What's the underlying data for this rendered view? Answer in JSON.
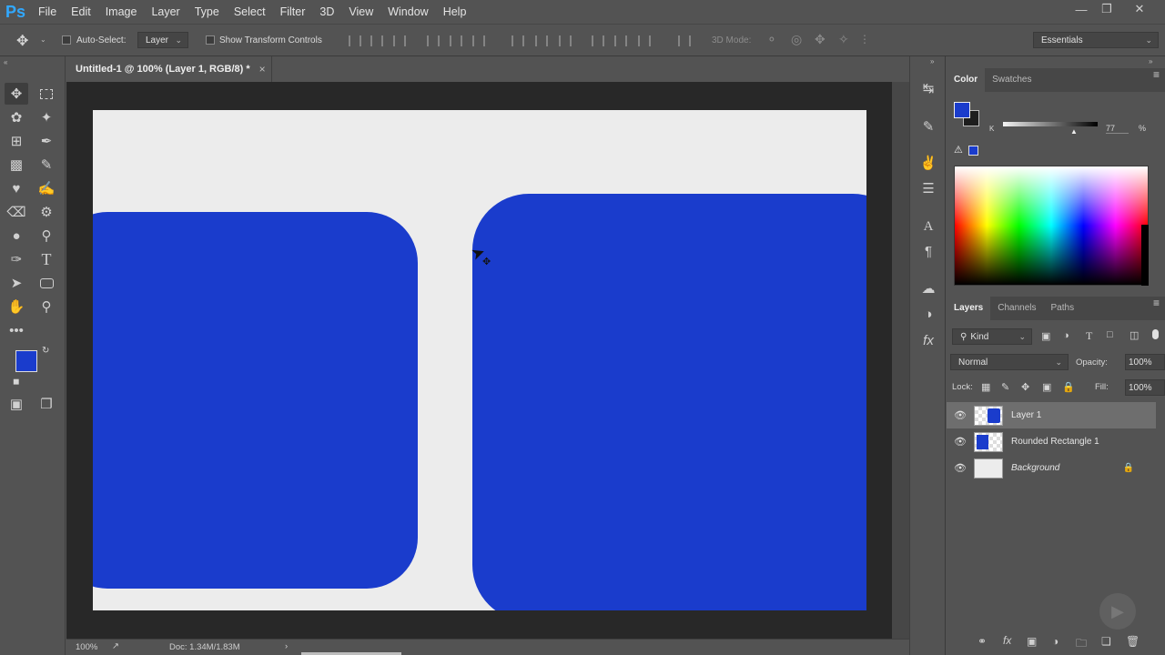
{
  "app": {
    "logo": "Ps"
  },
  "menu": [
    "File",
    "Edit",
    "Image",
    "Layer",
    "Type",
    "Select",
    "Filter",
    "3D",
    "View",
    "Window",
    "Help"
  ],
  "window_controls": [
    "minimize-icon",
    "restore-icon",
    "close-icon"
  ],
  "options": {
    "auto_select_label": "Auto-Select:",
    "auto_select_value": "Layer",
    "show_transform_label": "Show Transform Controls",
    "mode_3d_label": "3D Mode:",
    "workspace": "Essentials"
  },
  "document": {
    "tab_title": "Untitled-1 @ 100% (Layer 1, RGB/8) *",
    "close_glyph": "×"
  },
  "status": {
    "zoom": "100%",
    "doc_info": "Doc: 1.34M/1.83M",
    "arrow": "›"
  },
  "colors": {
    "foreground": "#1a3ccc",
    "background": "#1e1e1e",
    "shape": "#1a3ccc",
    "canvas": "#ececec"
  },
  "color_panel": {
    "tabs": [
      "Color",
      "Swatches"
    ],
    "slider_label": "K",
    "slider_value": "77",
    "unit": "%"
  },
  "layers_panel": {
    "tabs": [
      "Layers",
      "Channels",
      "Paths"
    ],
    "kind_label": "Kind",
    "blend_mode": "Normal",
    "opacity_label": "Opacity:",
    "opacity_value": "100%",
    "lock_label": "Lock:",
    "fill_label": "Fill:",
    "fill_value": "100%",
    "layers": [
      {
        "name": "Layer 1",
        "selected": true
      },
      {
        "name": "Rounded Rectangle 1",
        "selected": false
      },
      {
        "name": "Background",
        "selected": false,
        "locked": true
      }
    ]
  }
}
